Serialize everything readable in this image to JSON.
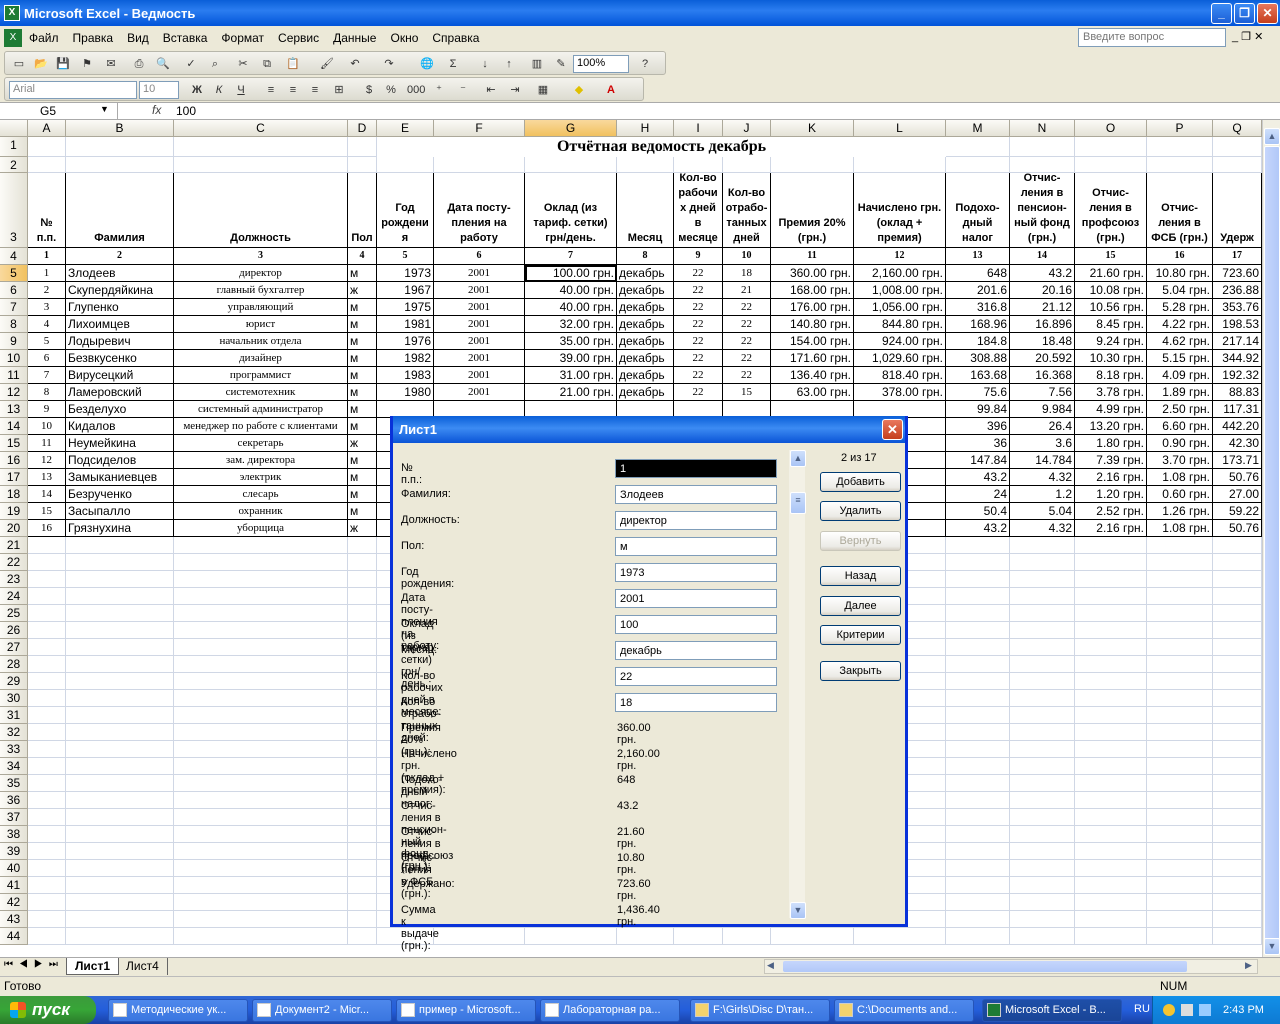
{
  "window": {
    "title": "Microsoft Excel - Ведмость"
  },
  "menu": [
    "Файл",
    "Правка",
    "Вид",
    "Вставка",
    "Формат",
    "Сервис",
    "Данные",
    "Окно",
    "Справка"
  ],
  "help_placeholder": "Введите вопрос",
  "toolbar": {
    "zoom": "100%",
    "font": "Arial",
    "size": "10"
  },
  "formula": {
    "name_box": "G5",
    "fx": "fx",
    "value": "100"
  },
  "columns": [
    "A",
    "B",
    "C",
    "D",
    "E",
    "F",
    "G",
    "H",
    "I",
    "J",
    "K",
    "L",
    "M",
    "N",
    "O",
    "P",
    "Q"
  ],
  "sheet": {
    "title": "Отчётная ведомость декабрь",
    "headers": [
      "№ п.п.",
      "Фамилия",
      "Должность",
      "Пол",
      "Год рождени я",
      "Дата посту-пления на работу",
      "Оклад (из тариф. сетки) грн/день.",
      "Месяц",
      "Кол-во рабочи х дней в месяце",
      "Кол-во отрабо-танных дней",
      "Премия 20% (грн.)",
      "Начислено грн. (оклад + премия)",
      "Подохо-дный налог",
      "Отчис-ления в пенсион-ный фонд (грн.)",
      "Отчис-ления в профсоюз (грн.)",
      "Отчис-ления в ФСБ (грн.)",
      "Удерж"
    ],
    "numbers": [
      "1",
      "2",
      "3",
      "4",
      "5",
      "6",
      "7",
      "8",
      "9",
      "10",
      "11",
      "12",
      "13",
      "14",
      "15",
      "16",
      "17"
    ],
    "rows": [
      [
        "1",
        "Злодеев",
        "директор",
        "м",
        "1973",
        "2001",
        "100.00 грн.",
        "декабрь",
        "22",
        "18",
        "360.00 грн.",
        "2,160.00 грн.",
        "648",
        "43.2",
        "21.60 грн.",
        "10.80 грн.",
        "723.60"
      ],
      [
        "2",
        "Скупердяйкина",
        "главный бухгалтер",
        "ж",
        "1967",
        "2001",
        "40.00 грн.",
        "декабрь",
        "22",
        "21",
        "168.00 грн.",
        "1,008.00 грн.",
        "201.6",
        "20.16",
        "10.08 грн.",
        "5.04 грн.",
        "236.88"
      ],
      [
        "3",
        "Глупенко",
        "управляющий",
        "м",
        "1975",
        "2001",
        "40.00 грн.",
        "декабрь",
        "22",
        "22",
        "176.00 грн.",
        "1,056.00 грн.",
        "316.8",
        "21.12",
        "10.56 грн.",
        "5.28 грн.",
        "353.76"
      ],
      [
        "4",
        "Лихоимцев",
        "юрист",
        "м",
        "1981",
        "2001",
        "32.00 грн.",
        "декабрь",
        "22",
        "22",
        "140.80 грн.",
        "844.80 грн.",
        "168.96",
        "16.896",
        "8.45 грн.",
        "4.22 грн.",
        "198.53"
      ],
      [
        "5",
        "Лодыревич",
        "начальник отдела",
        "м",
        "1976",
        "2001",
        "35.00 грн.",
        "декабрь",
        "22",
        "22",
        "154.00 грн.",
        "924.00 грн.",
        "184.8",
        "18.48",
        "9.24 грн.",
        "4.62 грн.",
        "217.14"
      ],
      [
        "6",
        "Безвкусенко",
        "дизайнер",
        "м",
        "1982",
        "2001",
        "39.00 грн.",
        "декабрь",
        "22",
        "22",
        "171.60 грн.",
        "1,029.60 грн.",
        "308.88",
        "20.592",
        "10.30 грн.",
        "5.15 грн.",
        "344.92"
      ],
      [
        "7",
        "Вирусецкий",
        "программист",
        "м",
        "1983",
        "2001",
        "31.00 грн.",
        "декабрь",
        "22",
        "22",
        "136.40 грн.",
        "818.40 грн.",
        "163.68",
        "16.368",
        "8.18 грн.",
        "4.09 грн.",
        "192.32"
      ],
      [
        "8",
        "Ламеровский",
        "системотехник",
        "м",
        "1980",
        "2001",
        "21.00 грн.",
        "декабрь",
        "22",
        "15",
        "63.00 грн.",
        "378.00 грн.",
        "75.6",
        "7.56",
        "3.78 грн.",
        "1.89 грн.",
        "88.83"
      ],
      [
        "9",
        "Безделухо",
        "системный администратор",
        "м",
        "",
        "",
        "",
        "",
        "",
        "",
        "",
        "",
        "99.84",
        "9.984",
        "4.99 грн.",
        "2.50 грн.",
        "117.31"
      ],
      [
        "10",
        "Кидалов",
        "менеджер по работе с клиентами",
        "м",
        "",
        "",
        "",
        "",
        "",
        "",
        "",
        "",
        "396",
        "26.4",
        "13.20 грн.",
        "6.60 грн.",
        "442.20"
      ],
      [
        "11",
        "Неумейкина",
        "секретарь",
        "ж",
        "",
        "",
        "",
        "",
        "",
        "",
        "",
        "",
        "36",
        "3.6",
        "1.80 грн.",
        "0.90 грн.",
        "42.30"
      ],
      [
        "12",
        "Подсиделов",
        "зам. директора",
        "м",
        "",
        "",
        "",
        "",
        "",
        "",
        "",
        "",
        "147.84",
        "14.784",
        "7.39 грн.",
        "3.70 грн.",
        "173.71"
      ],
      [
        "13",
        "Замыканиевцев",
        "электрик",
        "м",
        "",
        "",
        "",
        "",
        "",
        "",
        "",
        "",
        "43.2",
        "4.32",
        "2.16 грн.",
        "1.08 грн.",
        "50.76"
      ],
      [
        "14",
        " Безрученко",
        "слесарь",
        "м",
        "",
        "",
        "",
        "",
        "",
        "",
        "",
        "",
        "24",
        "1.2",
        "1.20 грн.",
        "0.60 грн.",
        "27.00"
      ],
      [
        "15",
        "Засыпалло",
        "охранник",
        "м",
        "",
        "",
        "",
        "",
        "",
        "",
        "",
        "",
        "50.4",
        "5.04",
        "2.52 грн.",
        "1.26 грн.",
        "59.22"
      ],
      [
        "16",
        "Грязнухина",
        "уборщица",
        "ж",
        "",
        "",
        "",
        "",
        "",
        "",
        "",
        "",
        "43.2",
        "4.32",
        "2.16 грн.",
        "1.08 грн.",
        "50.76"
      ]
    ]
  },
  "tabs": [
    "Лист1",
    "Лист4"
  ],
  "status": {
    "left": "Готово",
    "num": "NUM"
  },
  "dialog": {
    "title": "Лист1",
    "record_counter": "2 из 17",
    "inputs": [
      {
        "label": "№ п.п.:",
        "value": "1"
      },
      {
        "label": "Фамилия:",
        "value": "Злодеев"
      },
      {
        "label": "Должность:",
        "value": "директор"
      },
      {
        "label": "Пол:",
        "value": "м"
      },
      {
        "label": "Год рождения:",
        "value": "1973"
      },
      {
        "label": "Дата посту-пления на работу:",
        "value": "2001"
      },
      {
        "label": "Оклад (из тариф. сетки) грн/день.:",
        "value": "100"
      },
      {
        "label": "Месяц:",
        "value": "декабрь"
      },
      {
        "label": "Кол-во рабочих дней в месяце:",
        "value": "22"
      },
      {
        "label": "Кол-во отрабо-танных дней:",
        "value": "18"
      }
    ],
    "computed": [
      {
        "label": "Премия 20% (грн.):",
        "value": "360.00 грн."
      },
      {
        "label": "Начислено грн. (оклад + премия):",
        "value": "2,160.00 грн."
      },
      {
        "label": "Подохо-дный налог:",
        "value": "648"
      },
      {
        "label": "Отчис-ления в пенсион-ный фонд (грн.):",
        "value": "43.2"
      },
      {
        "label": "Отчис-ления в профсоюз (грн.):",
        "value": "21.60 грн."
      },
      {
        "label": "Отчис-ления в ФСБ (грн.):",
        "value": "10.80 грн."
      },
      {
        "label": "Удержано:",
        "value": "723.60 грн."
      },
      {
        "label": "Сумма к выдаче (грн.):",
        "value": "1,436.40 грн."
      }
    ],
    "buttons": {
      "add": "Добавить",
      "delete": "Удалить",
      "restore": "Вернуть",
      "back": "Назад",
      "next": "Далее",
      "criteria": "Критерии",
      "close": "Закрыть"
    }
  },
  "taskbar": {
    "start": "пуск",
    "items": [
      "Методические ук...",
      "Документ2 - Micr...",
      "пример - Microsoft...",
      "Лабораторная ра...",
      "F:\\Girls\\Disc D\\тан...",
      "C:\\Documents and...",
      "Microsoft Excel - В..."
    ],
    "lang": "RU",
    "clock": "2:43 PM"
  }
}
